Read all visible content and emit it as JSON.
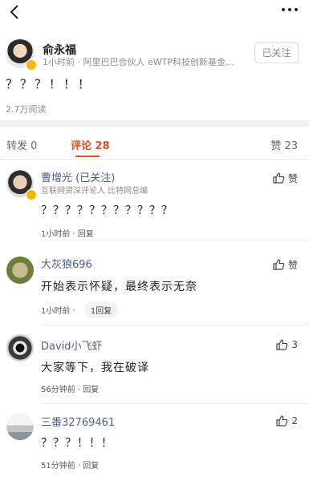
{
  "header": {
    "back_icon": "chevron-left-icon",
    "more_icon": "more-dots-icon"
  },
  "post": {
    "author": "俞永福",
    "meta": "1小时前 · 阿里巴巴合伙人 eWTP科技创新基金...",
    "follow_label": "已关注",
    "text": "？？？！！！",
    "reads": "2.7万阅读"
  },
  "tabs": {
    "repost": "转发 0",
    "comment": "评论 28",
    "like": "赞 23"
  },
  "comments": [
    {
      "name": "曹增光 (已关注)",
      "subtitle": "互联网资深评论人 比特网总编",
      "text": "？？？？？？？？？？？",
      "time": "1小时前",
      "reply": "回复",
      "like": "赞"
    },
    {
      "name": "大灰狼696",
      "text": "开始表示怀疑，最终表示无奈",
      "time": "1小时前",
      "reply_count": "1回复",
      "like": "赞"
    },
    {
      "name": "David小飞虾",
      "text": "大家等下，我在破译",
      "time": "56分钟前",
      "reply": "回复",
      "like": "3"
    },
    {
      "name": "三番32769461",
      "text": "？？？！！！",
      "time": "51分钟前",
      "reply": "回复",
      "like": "2"
    }
  ],
  "colors": {
    "accent": "#e05024",
    "name_blue": "#4d5f87",
    "badge_gold": "#f5b800"
  }
}
